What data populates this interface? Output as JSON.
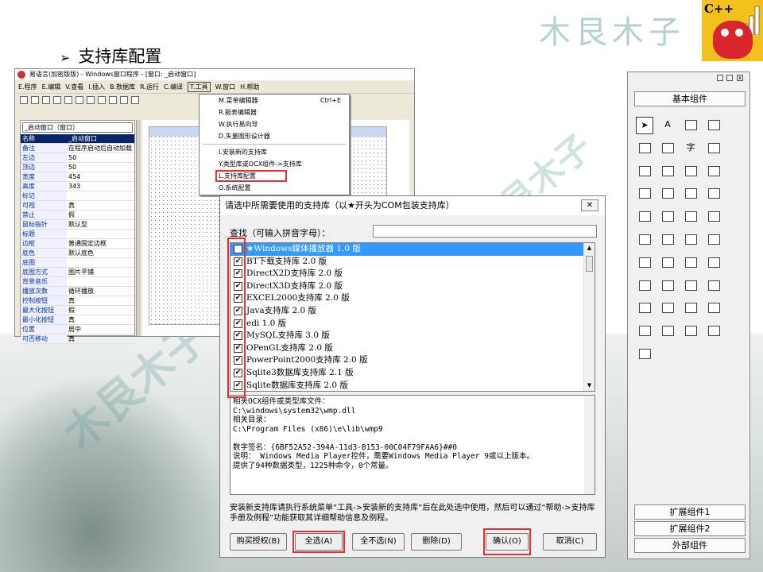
{
  "slide": {
    "title": "支持库配置",
    "bullet": "➢",
    "watermark": "木艮木子",
    "logo_text": "C++"
  },
  "ide": {
    "title": "易语言(加密版版) - Windows窗口程序 - [窗口: _启动窗口]",
    "menu": [
      "E.程序",
      "E.编辑",
      "V.查看",
      "I.插入",
      "B.数据库",
      "R.运行",
      "C.编译",
      "T.工具",
      "W.窗口",
      "H.帮助"
    ],
    "selected_menu": "T.工具",
    "props_combo": "_启动窗口（窗口）",
    "props": [
      [
        "名称",
        "_启动窗口"
      ],
      [
        "备注",
        "在程序启动后自动加载"
      ],
      [
        "左边",
        "50"
      ],
      [
        "顶边",
        "50"
      ],
      [
        "宽度",
        "454"
      ],
      [
        "高度",
        "343"
      ],
      [
        "标记",
        ""
      ],
      [
        "可视",
        "真"
      ],
      [
        "禁止",
        "假"
      ],
      [
        "鼠标指针",
        "默认型"
      ],
      [
        "标题",
        ""
      ],
      [
        "边框",
        "普通固定边框"
      ],
      [
        "底色",
        "默认底色"
      ],
      [
        "底图",
        ""
      ],
      [
        "底图方式",
        "图片平铺"
      ],
      [
        "背景音乐",
        ""
      ],
      [
        "播放次数",
        "循环播放"
      ],
      [
        "控制按钮",
        "真"
      ],
      [
        "最大化按钮",
        "假"
      ],
      [
        "最小化按钮",
        "真"
      ],
      [
        "位置",
        "居中"
      ],
      [
        "可否移动",
        "真"
      ]
    ]
  },
  "tools_menu": {
    "items": [
      {
        "label": "M.菜单编辑器",
        "shortcut": "Ctrl+E"
      },
      {
        "label": "R.报表编辑器",
        "shortcut": ""
      },
      {
        "label": "W.执行易向导",
        "shortcut": ""
      },
      {
        "label": "D.矢量图形设计器",
        "shortcut": ""
      },
      {
        "label": "I.安装新的支持库",
        "shortcut": ""
      },
      {
        "label": "Y.类型库或OCX组件->支持库",
        "shortcut": ""
      },
      {
        "label": "L.支持库配置",
        "shortcut": ""
      },
      {
        "label": "O.系统配置",
        "shortcut": ""
      }
    ]
  },
  "dialog": {
    "title": "请选中所需要使用的支持库（以★开头为COM包装支持库）",
    "close": "✕",
    "search_label": "查找（可输入拼音字母）：",
    "search_value": "",
    "libraries": [
      {
        "label": "★Windows媒体播放器 1.0 版",
        "checked": true,
        "selected": true
      },
      {
        "label": "BT下载支持库 2.0 版",
        "checked": true
      },
      {
        "label": "DirectX2D支持库 2.0 版",
        "checked": true
      },
      {
        "label": "DirectX3D支持库 2.0 版",
        "checked": true
      },
      {
        "label": "EXCEL2000支持库 2.0 版",
        "checked": true
      },
      {
        "label": "Java支持库 2.0 版",
        "checked": true
      },
      {
        "label": "edi 1.0 版",
        "checked": true
      },
      {
        "label": "MySQL支持库 3.0 版",
        "checked": true
      },
      {
        "label": "OPenGL支持库 2.0 版",
        "checked": true
      },
      {
        "label": "PowerPoint2000支持库 2.0 版",
        "checked": true
      },
      {
        "label": "Sqlite3数据库支持库 2.1 版",
        "checked": true
      },
      {
        "label": "Sqlite数据库支持库 2.0 版",
        "checked": true
      }
    ],
    "info_lines": [
      "相关OCX组件或类型库文件：",
      "C:\\windows\\system32\\wmp.dll",
      "相关目录：",
      "C:\\Program Files (x86)\\e\\lib\\wmp9",
      "",
      "数字签名：{6BF52A52-394A-11d3-B153-00C04F79FAA6}##0",
      "说明： Windows Media Player控件，需要Windows Media Player 9或以上版本。",
      "提供了94种数据类型，1225种命令，0个常量。"
    ],
    "note": "安装新支持库请执行系统菜单“工具->安装新的支持库”后在此处选中使用，然后可以通过“帮助->支持库手册及例程”功能获取其详细帮助信息及例程。",
    "buttons": {
      "buy": "购买授权(B)",
      "select_all": "全选(A)",
      "select_none": "全不选(N)",
      "delete": "删除(D)",
      "ok": "确认(O)",
      "cancel": "取消(C)"
    }
  },
  "palette": {
    "header": "基本组件",
    "footer": [
      "扩展组件1",
      "扩展组件2",
      "外部组件"
    ],
    "text_tool": "字",
    "label_tool": "A"
  }
}
